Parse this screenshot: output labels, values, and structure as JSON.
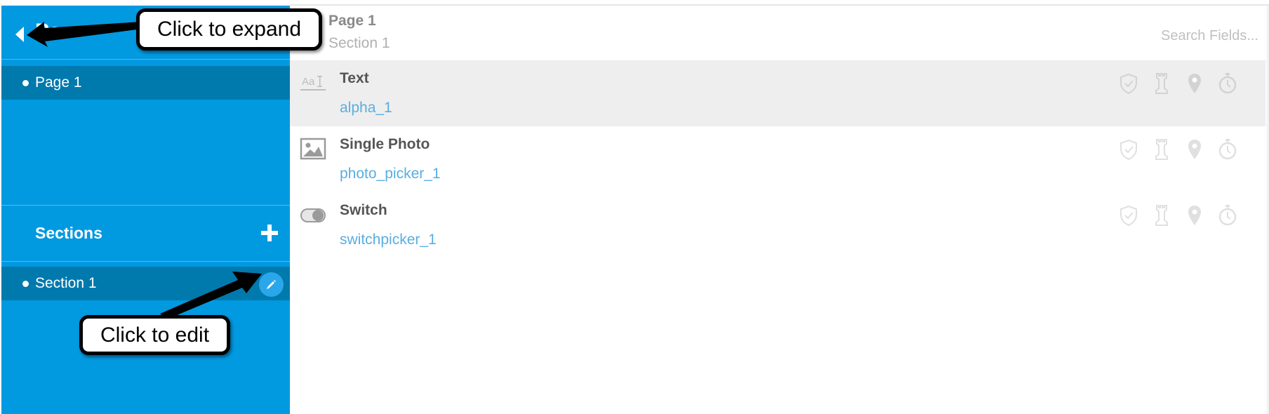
{
  "sidebar": {
    "pages": [
      {
        "label": "Page 1"
      }
    ],
    "sections_title": "Sections",
    "sections": [
      {
        "label": "Section 1"
      }
    ]
  },
  "header": {
    "page": "Page 1",
    "section": "Section 1"
  },
  "search": {
    "placeholder": "Search Fields..."
  },
  "fields": [
    {
      "name": "Text",
      "key": "alpha_1",
      "type_icon": "text-field-icon",
      "selected": true
    },
    {
      "name": "Single Photo",
      "key": "photo_picker_1",
      "type_icon": "photo-icon",
      "selected": false
    },
    {
      "name": "Switch",
      "key": "switchpicker_1",
      "type_icon": "switch-icon",
      "selected": false
    }
  ],
  "row_icons": [
    "shield-check-icon",
    "chess-rook-icon",
    "location-pin-icon",
    "stopwatch-icon"
  ],
  "callouts": {
    "expand": "Click to expand",
    "edit": "Click to edit"
  },
  "colors": {
    "sidebar_bg": "#0199e0",
    "sidebar_selected": "#0079ad",
    "edit_button": "#2aa6ea",
    "field_key": "#59aee0",
    "selected_row": "#eeeeee",
    "icon_gray": "#cccccc"
  }
}
